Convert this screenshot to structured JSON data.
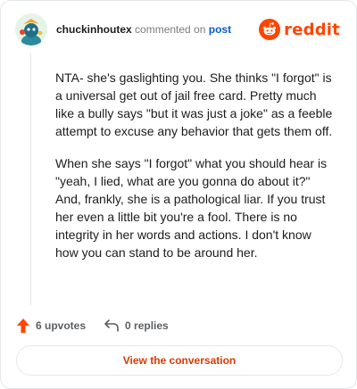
{
  "header": {
    "username": "chuckinhoutex",
    "commented_on": "commented on",
    "post_link": "post",
    "brand": "reddit"
  },
  "comment": {
    "paragraphs": [
      "NTA- she's gaslighting you. She thinks \"I forgot\" is a universal get out of jail free card. Pretty much like a bully says \"but it was just a joke\" as a feeble attempt to excuse any behavior that gets them off.",
      "When she says \"I forgot\" what you should hear is \"yeah, I lied, what are you gonna do about it?\" And, frankly, she is a pathological liar. If you trust her even a little bit you're a fool. There is no integrity in her words and actions. I don't know how you can stand to be around her."
    ]
  },
  "footer": {
    "upvotes": "6 upvotes",
    "replies": "0 replies",
    "cta": "View the conversation"
  },
  "colors": {
    "reddit_orange": "#ff4500",
    "link_blue": "#0b5bd3",
    "cta_text": "#d93a00"
  }
}
